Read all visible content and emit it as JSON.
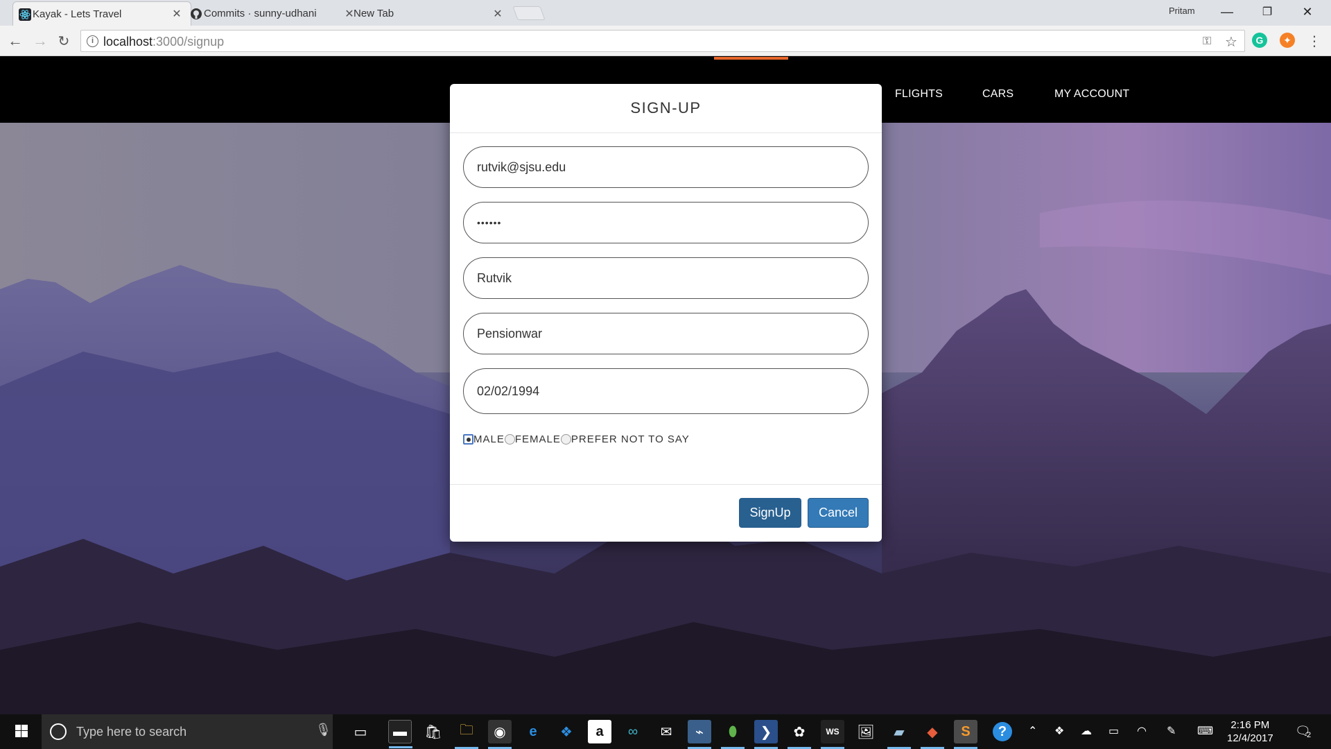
{
  "browser": {
    "tabs": [
      {
        "title": "Kayak - Lets Travel",
        "icon": "react-icon",
        "active": true
      },
      {
        "title": "Commits · sunny-udhani",
        "icon": "github-icon",
        "active": false
      },
      {
        "title": "New Tab",
        "icon": "",
        "active": false
      }
    ],
    "profile_name": "Pritam",
    "url_host": "localhost",
    "url_path": ":3000/signup"
  },
  "navbar": {
    "links": [
      "FLIGHTS",
      "CARS",
      "MY ACCOUNT"
    ],
    "accent_color": "#e8662a"
  },
  "modal": {
    "title": "SIGN-UP",
    "fields": {
      "email": "rutvik@sjsu.edu",
      "password": "••••••",
      "first_name": "Rutvik",
      "last_name": "Pensionwar",
      "dob": "02/02/1994"
    },
    "gender_options": [
      {
        "label": "MALE",
        "checked": true
      },
      {
        "label": "FEMALE",
        "checked": false
      },
      {
        "label": "PREFER NOT TO SAY",
        "checked": false
      }
    ],
    "buttons": {
      "signup": "SignUp",
      "cancel": "Cancel"
    },
    "colors": {
      "signup": "#286090",
      "cancel": "#337ab7"
    }
  },
  "taskbar": {
    "search_placeholder": "Type here to search",
    "time": "2:16 PM",
    "date": "12/4/2017",
    "notification_count": "2"
  }
}
